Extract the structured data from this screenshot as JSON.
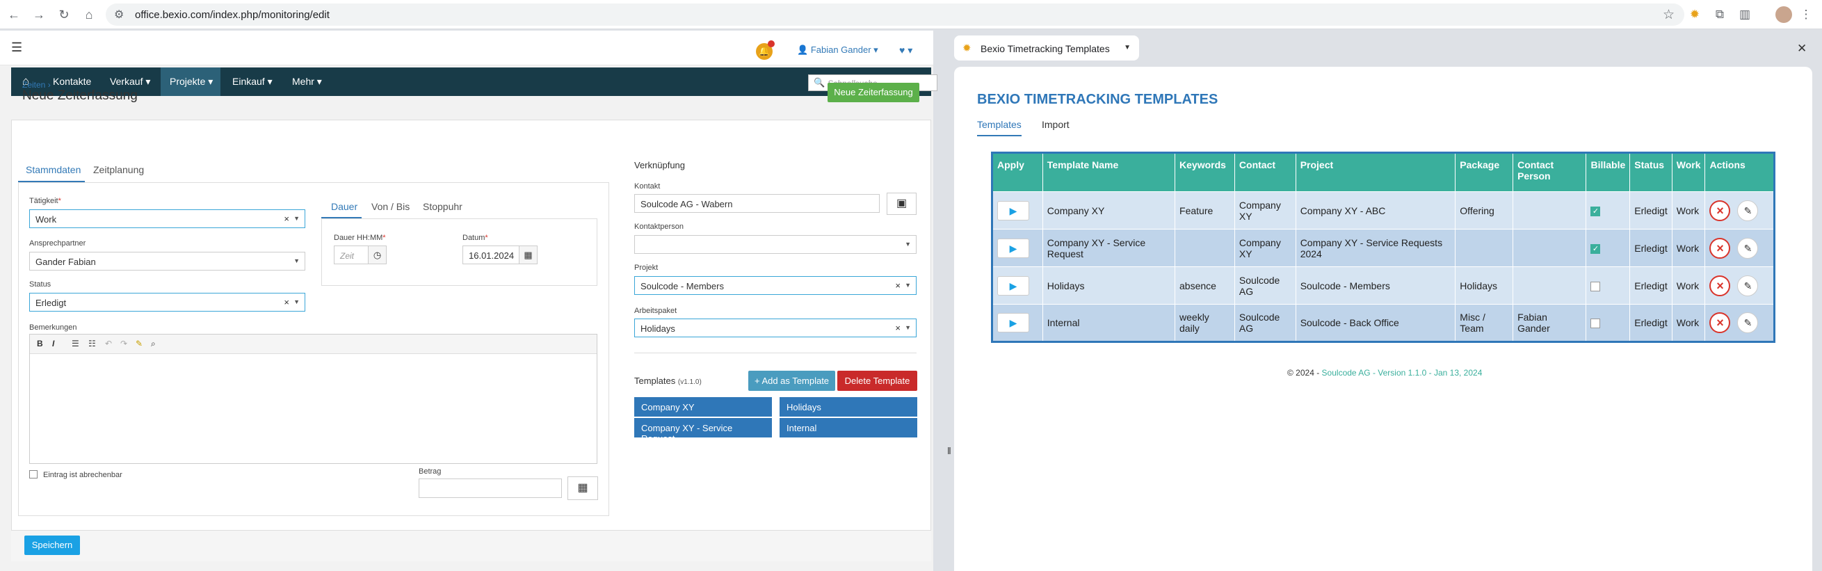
{
  "browser": {
    "url": "office.bexio.com/index.php/monitoring/edit"
  },
  "app": {
    "user_name": "Fabian Gander",
    "nav": {
      "items": [
        "Kontakte",
        "Verkauf ▾",
        "Projekte ▾",
        "Einkauf ▾",
        "Mehr ▾"
      ],
      "search_placeholder": "Schnellsuche"
    },
    "breadcrumb": "Zeiten",
    "page_title": "Neue Zeiterfassung",
    "new_button": "Neue Zeiterfassung",
    "tabs": [
      "Stammdaten",
      "Zeitplanung"
    ],
    "form": {
      "taetigkeit_label": "Tätigkeit",
      "taetigkeit_value": "Work",
      "ansprechpartner_label": "Ansprechpartner",
      "ansprechpartner_value": "Gander Fabian",
      "status_label": "Status",
      "status_value": "Erledigt",
      "bemerkungen_label": "Bemerkungen",
      "abrechenbar_label": "Eintrag ist abrechenbar",
      "betrag_label": "Betrag",
      "time_tabs": [
        "Dauer",
        "Von / Bis",
        "Stoppuhr"
      ],
      "dauer_label": "Dauer HH:MM",
      "dauer_placeholder": "Zeit",
      "datum_label": "Datum",
      "datum_value": "16.01.2024"
    },
    "verknuepfung": {
      "title": "Verknüpfung",
      "kontakt_label": "Kontakt",
      "kontakt_value": "Soulcode AG - Wabern",
      "kontaktperson_label": "Kontaktperson",
      "projekt_label": "Projekt",
      "projekt_value": "Soulcode - Members",
      "arbeitspaket_label": "Arbeitspaket",
      "arbeitspaket_value": "Holidays"
    },
    "templates": {
      "title": "Templates",
      "version": "(v1.1.0)",
      "add_label": "+ Add as Template",
      "delete_label": "Delete Template",
      "buttons": [
        "Company XY",
        "Holidays",
        "Company XY - Service Request",
        "Internal"
      ]
    },
    "save_label": "Speichern"
  },
  "extension": {
    "tab_title": "Bexio Timetracking Templates",
    "heading": "BEXIO TIMETRACKING TEMPLATES",
    "tabs": [
      "Templates",
      "Import"
    ],
    "columns": [
      "Apply",
      "Template Name",
      "Keywords",
      "Contact",
      "Project",
      "Package",
      "Contact Person",
      "Billable",
      "Status",
      "Work",
      "Actions"
    ],
    "rows": [
      {
        "name": "Company XY",
        "keywords": "Feature",
        "contact": "Company XY",
        "project": "Company XY - ABC",
        "package": "Offering",
        "person": "",
        "billable": true,
        "status": "Erledigt",
        "work": "Work"
      },
      {
        "name": "Company XY - Service Request",
        "keywords": "",
        "contact": "Company XY",
        "project": "Company XY - Service Requests 2024",
        "package": "",
        "person": "",
        "billable": true,
        "status": "Erledigt",
        "work": "Work"
      },
      {
        "name": "Holidays",
        "keywords": "absence",
        "contact": "Soulcode AG",
        "project": "Soulcode - Members",
        "package": "Holidays",
        "person": "",
        "billable": false,
        "status": "Erledigt",
        "work": "Work"
      },
      {
        "name": "Internal",
        "keywords": "weekly daily",
        "contact": "Soulcode AG",
        "project": "Soulcode - Back Office",
        "package": "Misc / Team",
        "person": "Fabian Gander",
        "billable": false,
        "status": "Erledigt",
        "work": "Work"
      }
    ],
    "footer_prefix": "© 2024 - ",
    "footer_company": "Soulcode AG",
    "footer_version": " - Version 1.1.0 - Jan 13, 2024"
  }
}
